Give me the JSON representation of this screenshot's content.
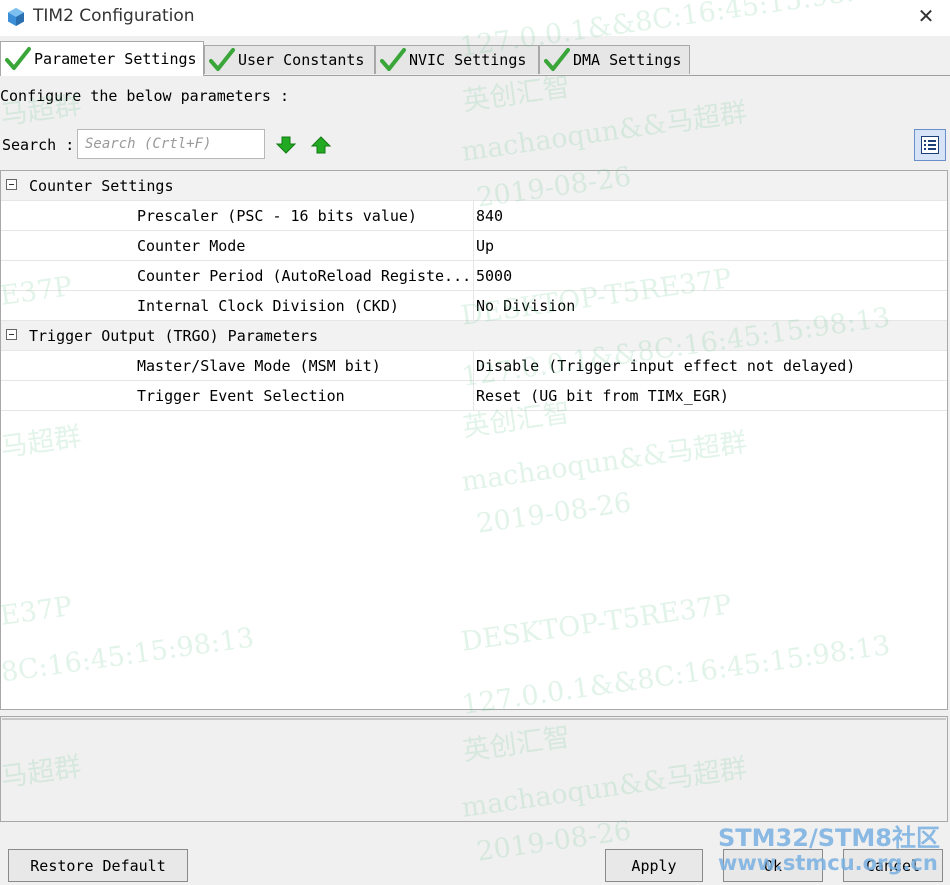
{
  "window": {
    "title": "TIM2 Configuration"
  },
  "tabs": [
    {
      "label": "Parameter Settings",
      "active": true
    },
    {
      "label": "User Constants",
      "active": false
    },
    {
      "label": "NVIC Settings",
      "active": false
    },
    {
      "label": "DMA Settings",
      "active": false
    }
  ],
  "description": "Configure the below parameters :",
  "search": {
    "label": "Search :",
    "placeholder": "Search (Crtl+F)"
  },
  "groups": [
    {
      "title": "Counter Settings",
      "params": [
        {
          "name": "Prescaler (PSC - 16 bits value)",
          "value": "840"
        },
        {
          "name": "Counter Mode",
          "value": "Up"
        },
        {
          "name": "Counter Period (AutoReload Registe...",
          "value": "5000"
        },
        {
          "name": "Internal Clock Division (CKD)",
          "value": "No Division"
        }
      ]
    },
    {
      "title": "Trigger Output (TRGO) Parameters",
      "params": [
        {
          "name": "Master/Slave Mode (MSM bit)",
          "value": "Disable (Trigger input effect not delayed)"
        },
        {
          "name": "Trigger Event Selection",
          "value": "Reset (UG bit from TIMx_EGR)"
        }
      ]
    }
  ],
  "buttons": {
    "restore": "Restore Default",
    "apply": "Apply",
    "ok": "Ok",
    "cancel": "Cancel"
  },
  "watermarks": [
    "127.0.0.1&&8C:16:45:15:98:13",
    "英创汇智",
    "machaoqun&&马超群",
    "2019-08-26",
    "DESKTOP-T5RE37P",
    "马超群",
    "E37P",
    "8C:16:45:15:98:13"
  ],
  "brand": {
    "line1": "STM32/STM8社区",
    "line2": "www.stmcu.org.cn"
  },
  "colors": {
    "check": "#3aa63a",
    "arrow_green": "#22aa22",
    "selected_blue": "#d7e4f7"
  }
}
